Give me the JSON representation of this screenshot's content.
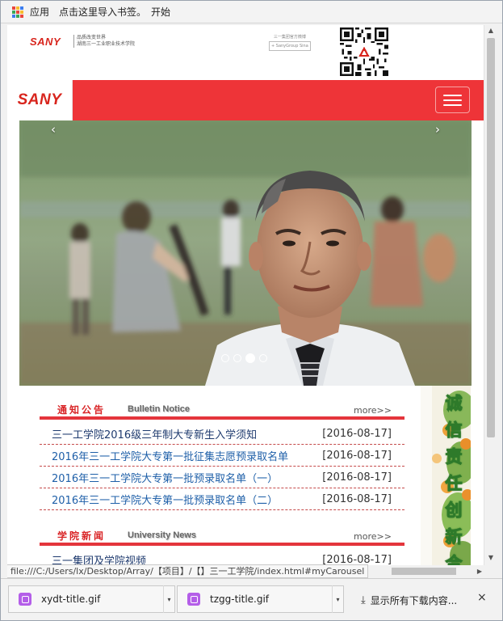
{
  "bookmarks_bar": {
    "apps_label": "应用",
    "import_label": "点击这里导入书签。",
    "start_label": "开始"
  },
  "site": {
    "header": {
      "logo_text": "SANY",
      "school_line1": "品质改变世界",
      "school_line2": "湖南三一工业职业技术学院",
      "weibo_line1": "三一集团官方微博",
      "weibo_chip": "+ SanyGroup Sina"
    },
    "nav": {
      "logo_text": "SANY"
    },
    "carousel": {
      "prev_label": "‹",
      "next_label": "›",
      "slide_count": 4,
      "active_index": 2
    },
    "notice": {
      "title_cn": "通知公告",
      "title_en": "Bulletin Notice",
      "more_label": "more>>",
      "items": [
        {
          "title": "三一工学院2016级三年制大专新生入学须知",
          "date": "[2016-08-17]"
        },
        {
          "title": "2016年三一工学院大专第一批征集志愿预录取名单",
          "date": "[2016-08-17]"
        },
        {
          "title": "2016年三一工学院大专第一批预录取名单（一）",
          "date": "[2016-08-17]"
        },
        {
          "title": "2016年三一工学院大专第一批预录取名单（二）",
          "date": "[2016-08-17]"
        }
      ]
    },
    "news": {
      "title_cn": "学院新闻",
      "title_en": "University News",
      "more_label": "more>>",
      "items": [
        {
          "title": "三一集团及学院视频",
          "date": "[2016-08-17]"
        }
      ]
    },
    "slogan": [
      "诚",
      "信",
      "责",
      "任",
      "创",
      "新",
      "合"
    ]
  },
  "status": {
    "url": "file:///C:/Users/lx/Desktop/Array/【项目】/【】三一工学院/index.html#myCarousel"
  },
  "downloads": {
    "items": [
      {
        "name": "xydt-title.gif"
      },
      {
        "name": "tzgg-title.gif"
      }
    ],
    "show_all_label": "显示所有下载内容...",
    "close_label": "×"
  },
  "colors": {
    "brand_red": "#ee3438",
    "link_blue": "#1e5fa8",
    "slogan_green": "#2e7a2a"
  }
}
